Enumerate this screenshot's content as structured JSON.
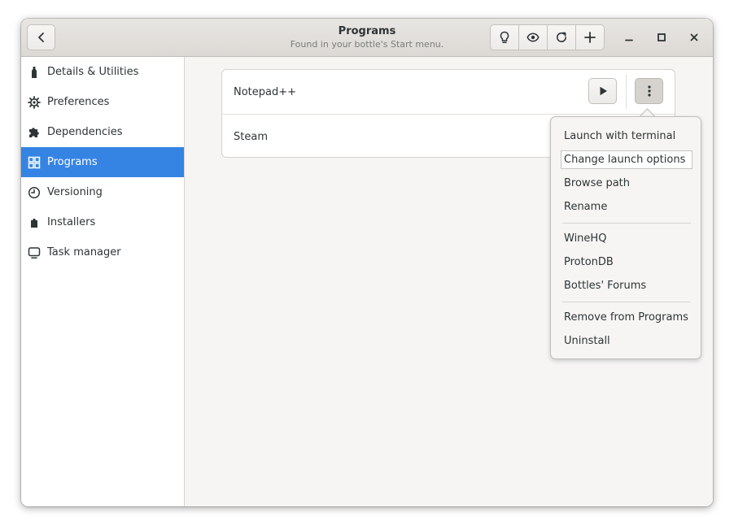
{
  "header": {
    "title": "Programs",
    "subtitle": "Found in your bottle's Start menu.",
    "back_icon": "chevron-left-icon",
    "tools": [
      "lightbulb-icon",
      "eye-icon",
      "refresh-icon",
      "plus-icon"
    ],
    "window_controls": [
      "minimize-icon",
      "maximize-icon",
      "close-icon"
    ]
  },
  "sidebar": {
    "items": [
      {
        "label": "Details & Utilities",
        "icon": "bottle-icon"
      },
      {
        "label": "Preferences",
        "icon": "gear-icon"
      },
      {
        "label": "Dependencies",
        "icon": "puzzle-icon"
      },
      {
        "label": "Programs",
        "icon": "grid-icon",
        "active": true
      },
      {
        "label": "Versioning",
        "icon": "clock-icon"
      },
      {
        "label": "Installers",
        "icon": "package-icon"
      },
      {
        "label": "Task manager",
        "icon": "monitor-icon"
      }
    ]
  },
  "programs": [
    {
      "name": "Notepad++"
    },
    {
      "name": "Steam"
    }
  ],
  "menu": {
    "group1": [
      "Launch with terminal",
      "Change launch options",
      "Browse path",
      "Rename"
    ],
    "group2": [
      "WineHQ",
      "ProtonDB",
      "Bottles' Forums"
    ],
    "group3": [
      "Remove from Programs",
      "Uninstall"
    ]
  },
  "colors": {
    "accent": "#3584e4",
    "window_bg": "#f6f5f4",
    "text": "#2e3436"
  }
}
